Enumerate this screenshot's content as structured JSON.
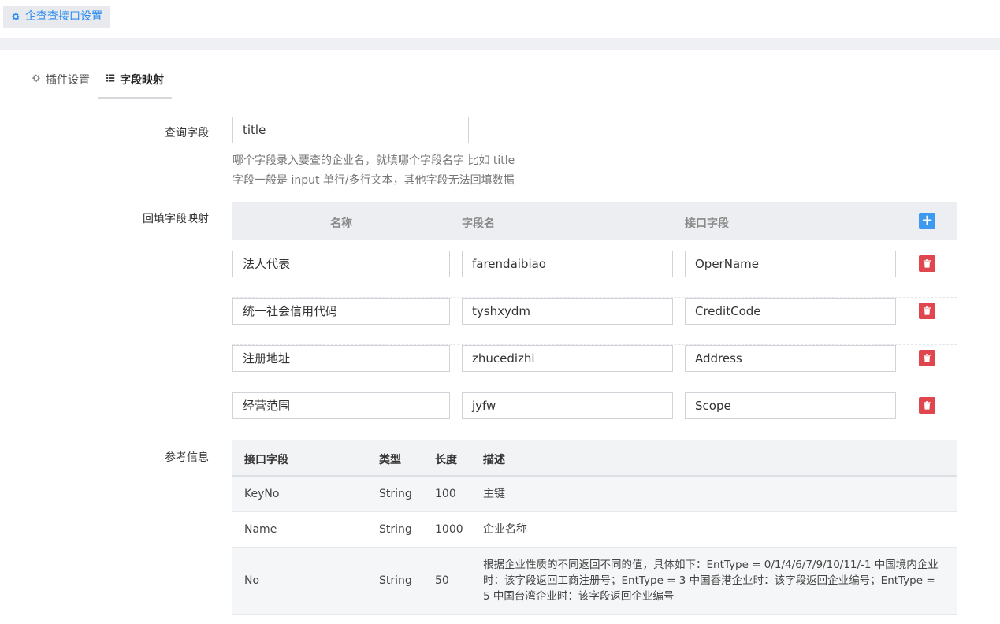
{
  "header": {
    "title": "企查查接口设置",
    "icon": "gear-icon"
  },
  "tabs": [
    {
      "label": "插件设置",
      "icon": "gear-icon",
      "active": false
    },
    {
      "label": "字段映射",
      "icon": "list-icon",
      "active": true
    }
  ],
  "query_field": {
    "label": "查询字段",
    "value": "title",
    "help_1": "哪个字段录入要查的企业名，就填哪个字段名字 比如 title",
    "help_2": "字段一般是 input 单行/多行文本，其他字段无法回填数据"
  },
  "mapping": {
    "label": "回填字段映射",
    "columns": [
      "名称",
      "字段名",
      "接口字段"
    ],
    "add_icon": "plus-icon",
    "delete_icon": "trash-icon",
    "rows": [
      {
        "name": "法人代表",
        "field": "farendaibiao",
        "api": "OperName"
      },
      {
        "name": "统一社会信用代码",
        "field": "tyshxydm",
        "api": "CreditCode"
      },
      {
        "name": "注册地址",
        "field": "zhucedizhi",
        "api": "Address"
      },
      {
        "name": "经营范围",
        "field": "jyfw",
        "api": "Scope"
      }
    ]
  },
  "reference": {
    "label": "参考信息",
    "columns": [
      "接口字段",
      "类型",
      "长度",
      "描述"
    ],
    "rows": [
      {
        "field": "KeyNo",
        "type": "String",
        "length": "100",
        "desc": "主键"
      },
      {
        "field": "Name",
        "type": "String",
        "length": "1000",
        "desc": "企业名称"
      },
      {
        "field": "No",
        "type": "String",
        "length": "50",
        "desc": "根据企业性质的不同返回不同的值，具体如下：EntType = 0/1/4/6/7/9/10/11/-1 中国境内企业时：该字段返回工商注册号；EntType = 3 中国香港企业时：该字段返回企业编号；EntType = 5 中国台湾企业时：该字段返回企业编号"
      }
    ]
  },
  "colors": {
    "accent": "#2d8cf0",
    "add": "#3d9af0",
    "delete": "#e0464e"
  }
}
